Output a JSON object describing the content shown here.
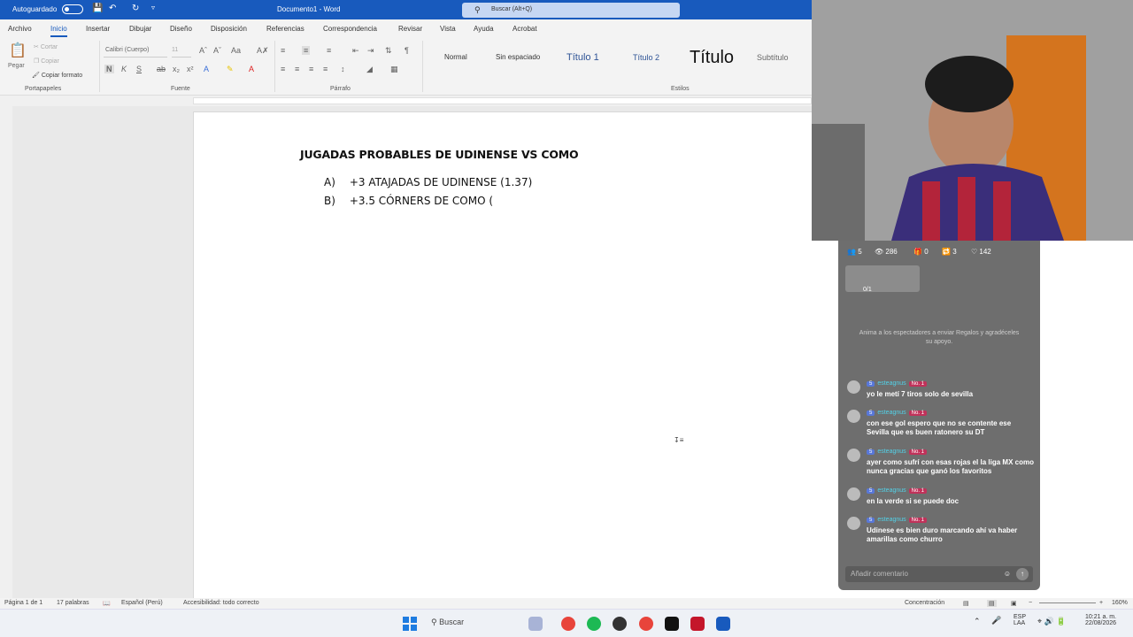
{
  "titlebar": {
    "autosave_label": "Autoguardado",
    "doc_title": "Documento1 - Word",
    "search_placeholder": "Buscar (Alt+Q)"
  },
  "ribbon_tabs": [
    "Archivo",
    "Inicio",
    "Insertar",
    "Dibujar",
    "Diseño",
    "Disposición",
    "Referencias",
    "Correspondencia",
    "Revisar",
    "Vista",
    "Ayuda",
    "Acrobat"
  ],
  "ribbon": {
    "paste_label": "Pegar",
    "cut_label": "Cortar",
    "copy_label": "Copiar",
    "format_painter_label": "Copiar formato",
    "font_name": "Calibri (Cuerpo)",
    "font_size": "11",
    "group_clipboard": "Portapapeles",
    "group_font": "Fuente",
    "group_paragraph": "Párrafo",
    "group_styles": "Estilos",
    "styles": [
      "Normal",
      "Sin espaciado",
      "Título 1",
      "Título 2",
      "Título",
      "Subtítulo"
    ]
  },
  "document": {
    "title": "JUGADAS PROBABLES DE UDINENSE VS COMO",
    "items": [
      {
        "marker": "A)",
        "text": "+3 ATAJADAS DE UDINENSE (1.37)"
      },
      {
        "marker": "B)",
        "text": "+3.5 CÓRNERS DE COMO ("
      }
    ]
  },
  "statusbar": {
    "page": "Página 1 de 1",
    "words": "17 palabras",
    "language": "Español (Perú)",
    "accessibility": "Accesibilidad: todo correcto",
    "focus": "Concentración",
    "zoom": "160%"
  },
  "taskbar": {
    "search_label": "Buscar",
    "lang": "ESP",
    "lang2": "LAA",
    "time": "10:21 a. m.",
    "date": "22/08/2026"
  },
  "live": {
    "stat_members": "5",
    "stat_viewers": "286",
    "stat_gifts": "0",
    "stat_shares": "3",
    "stat_likes": "142",
    "gift_progress": "0/1",
    "info_text": "Anima a los espectadores a enviar Regalos y agradéceles su apoyo.",
    "comment_placeholder": "Añadir comentario",
    "comments": [
      {
        "level": "5",
        "user": "esteagnus",
        "badge": "No. 1",
        "text": "yo le metí 7 tiros solo de sevilla"
      },
      {
        "level": "5",
        "user": "esteagnus",
        "badge": "No. 1",
        "text": "con ese gol espero que no se contente ese Sevilla que es buen ratonero su DT"
      },
      {
        "level": "5",
        "user": "esteagnus",
        "badge": "No. 1",
        "text": "ayer como sufrí con esas rojas el la liga MX como nunca gracias que ganó los favoritos"
      },
      {
        "level": "5",
        "user": "esteagnus",
        "badge": "No. 1",
        "text": "en la verde si se puede doc"
      },
      {
        "level": "5",
        "user": "esteagnus",
        "badge": "No. 1",
        "text": "Udinese es bien duro marcando ahí va haber amarillas como churro"
      }
    ]
  },
  "colors": {
    "word_blue": "#185abd",
    "live_bg": "#6e6e6e",
    "username": "#52d1e8"
  }
}
